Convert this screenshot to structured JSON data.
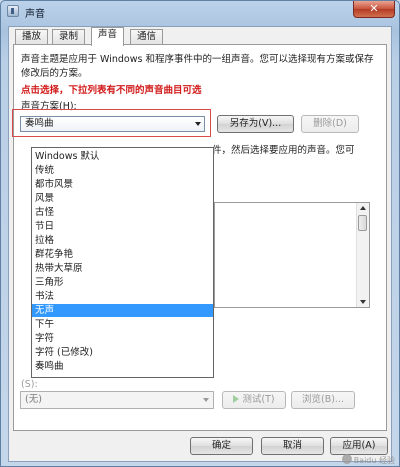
{
  "window": {
    "title": "声音",
    "close_label": "✕"
  },
  "tabs": [
    "播放",
    "录制",
    "声音",
    "通信"
  ],
  "panel": {
    "description": "声音主题是应用于 Windows 和程序事件中的一组声音。您可以选择现有方案或保存修改后的方案。",
    "annotation": "点击选择，下拉列表有不同的声音曲目可选",
    "scheme_label": "声音方案(H):",
    "scheme_value": "奏鸣曲",
    "save_as_label": "另存为(V)...",
    "delete_label": "删除(D)",
    "partial_text": "件，然后选择要应用的声音。您可",
    "sound_value": "(无)",
    "test_label": "测试(T)",
    "browse_label": "浏览(B)...",
    "sound_label_partial": "(S):"
  },
  "dropdown_options": [
    "Windows 默认",
    "传统",
    "都市风景",
    "风景",
    "古怪",
    "节日",
    "拉格",
    "群花争艳",
    "热带大草原",
    "三角形",
    "书法",
    "无声",
    "下午",
    "字符",
    "字符 (已修改)",
    "奏鸣曲"
  ],
  "dropdown_selected": "无声",
  "footer": {
    "ok": "确定",
    "cancel": "取消",
    "apply": "应用(A)"
  },
  "watermark": "Baidu 经验",
  "colors": {
    "selection": "#3399ff",
    "annotation": "#d21b1b"
  }
}
